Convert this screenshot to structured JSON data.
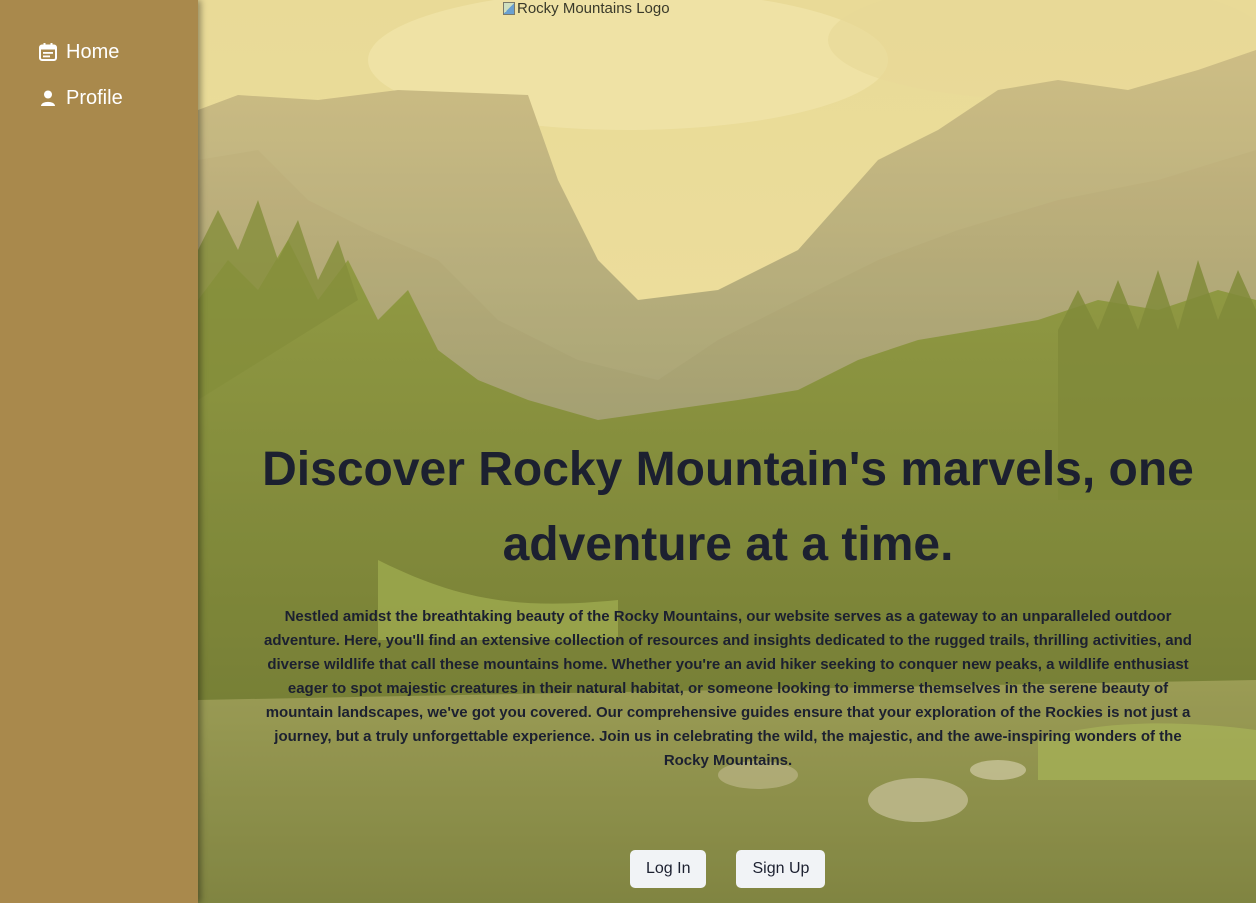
{
  "sidebar": {
    "items": [
      {
        "label": "Home",
        "icon": "calendar-icon"
      },
      {
        "label": "Profile",
        "icon": "person-icon"
      }
    ],
    "background": "#a9894c"
  },
  "header": {
    "logo_alt": "Rocky Mountains Logo"
  },
  "hero": {
    "title": "Discover Rocky Mountain's marvels, one adventure at a time.",
    "description": "Nestled amidst the breathtaking beauty of the Rocky Mountains, our website serves as a gateway to an unparalleled outdoor adventure. Here, you'll find an extensive collection of resources and insights dedicated to the rugged trails, thrilling activities, and diverse wildlife that call these mountains home. Whether you're an avid hiker seeking to conquer new peaks, a wildlife enthusiast eager to spot majestic creatures in their natural habitat, or someone looking to immerse themselves in the serene beauty of mountain landscapes, we've got you covered. Our comprehensive guides ensure that your exploration of the Rockies is not just a journey, but a truly unforgettable experience. Join us in celebrating the wild, the majestic, and the awe-inspiring wonders of the Rocky Mountains."
  },
  "actions": {
    "login_label": "Log In",
    "signup_label": "Sign Up"
  },
  "colors": {
    "text": "#1c2030",
    "button_bg": "#f1f3f6"
  }
}
